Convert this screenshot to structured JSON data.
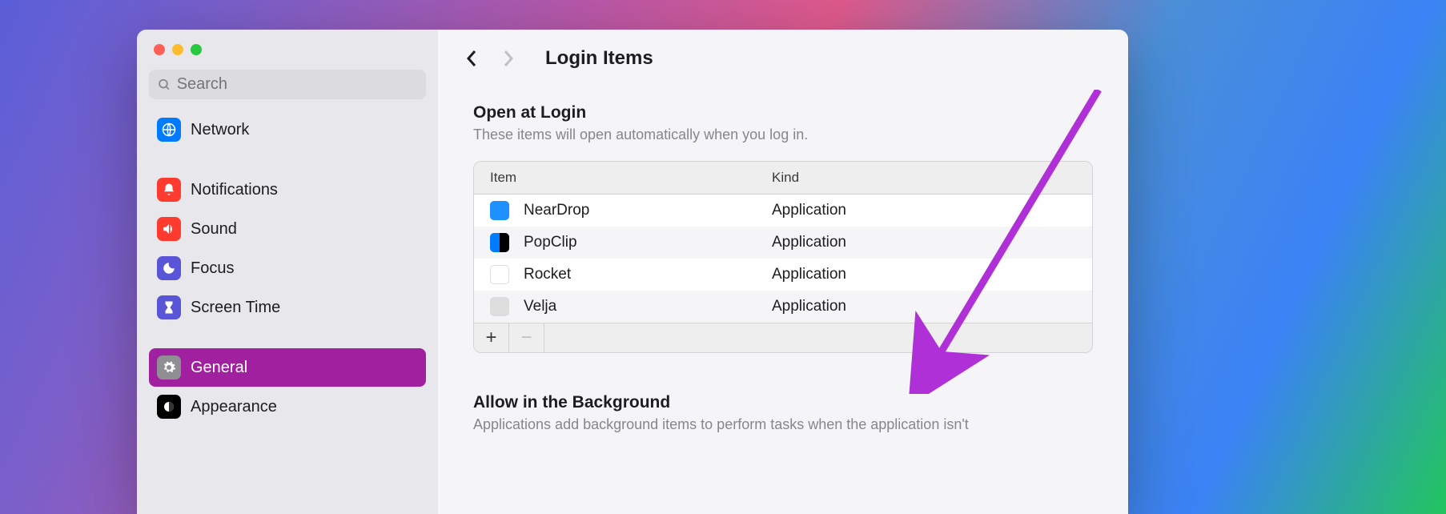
{
  "sidebar": {
    "search_placeholder": "Search",
    "items": [
      {
        "label": "Network",
        "icon": "network"
      },
      {
        "label": "Notifications",
        "icon": "notifications"
      },
      {
        "label": "Sound",
        "icon": "sound"
      },
      {
        "label": "Focus",
        "icon": "focus"
      },
      {
        "label": "Screen Time",
        "icon": "screentime"
      },
      {
        "label": "General",
        "icon": "general"
      },
      {
        "label": "Appearance",
        "icon": "appearance"
      }
    ]
  },
  "header": {
    "title": "Login Items"
  },
  "section_open": {
    "title": "Open at Login",
    "description": "These items will open automatically when you log in."
  },
  "table": {
    "col_item": "Item",
    "col_kind": "Kind",
    "rows": [
      {
        "name": "NearDrop",
        "kind": "Application",
        "icon": "neardrop"
      },
      {
        "name": "PopClip",
        "kind": "Application",
        "icon": "popclip"
      },
      {
        "name": "Rocket",
        "kind": "Application",
        "icon": "rocket"
      },
      {
        "name": "Velja",
        "kind": "Application",
        "icon": "velja"
      }
    ]
  },
  "section_bg": {
    "title": "Allow in the Background",
    "description": "Applications add background items to perform tasks when the application isn't"
  },
  "annotation": {
    "color": "#B030D8"
  }
}
